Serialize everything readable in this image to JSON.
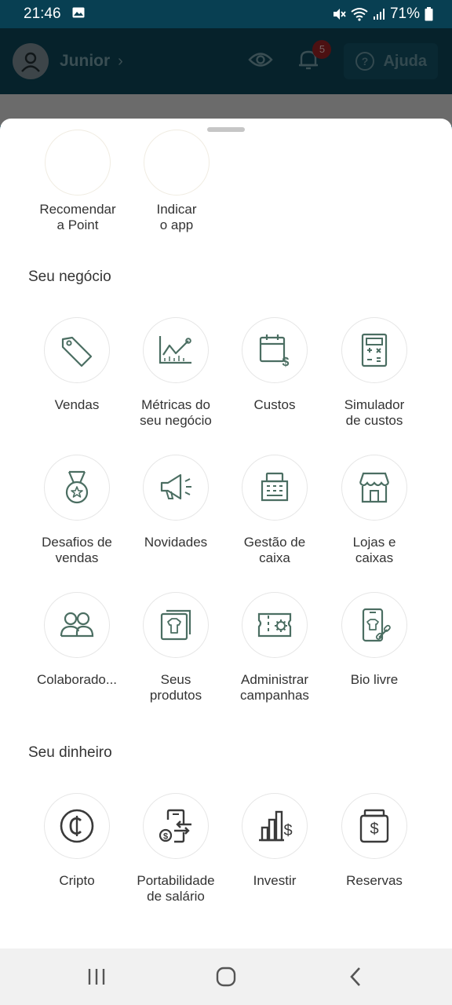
{
  "status_bar": {
    "time": "21:46",
    "battery": "71%"
  },
  "header": {
    "username": "Junior",
    "notification_count": "5",
    "help_label": "Ajuda"
  },
  "top_row": [
    {
      "label": "Recomendar\na Point"
    },
    {
      "label": "Indicar\no app"
    }
  ],
  "sections": {
    "business": {
      "title": "Seu negócio",
      "items": [
        {
          "label": "Vendas",
          "icon": "tag-icon"
        },
        {
          "label": "Métricas do\nseu negócio",
          "icon": "chart-line-icon"
        },
        {
          "label": "Custos",
          "icon": "calendar-cost-icon"
        },
        {
          "label": "Simulador\nde custos",
          "icon": "calculator-icon"
        },
        {
          "label": "Desafios de\nvendas",
          "icon": "medal-icon"
        },
        {
          "label": "Novidades",
          "icon": "megaphone-icon"
        },
        {
          "label": "Gestão de\ncaixa",
          "icon": "cash-register-icon"
        },
        {
          "label": "Lojas e\ncaixas",
          "icon": "store-icon"
        },
        {
          "label": "Colaborado...",
          "icon": "people-icon"
        },
        {
          "label": "Seus\nprodutos",
          "icon": "products-icon"
        },
        {
          "label": "Administrar\ncampanhas",
          "icon": "campaign-ticket-icon"
        },
        {
          "label": "Bio livre",
          "icon": "bio-link-icon"
        }
      ]
    },
    "money": {
      "title": "Seu dinheiro",
      "items": [
        {
          "label": "Cripto",
          "icon": "crypto-coin-icon"
        },
        {
          "label": "Portabilidade\nde salário",
          "icon": "salary-portability-icon"
        },
        {
          "label": "Investir",
          "icon": "invest-chart-icon"
        },
        {
          "label": "Reservas",
          "icon": "savings-jar-icon"
        }
      ]
    }
  },
  "nav": {
    "recent": "recent-apps-icon",
    "home": "home-icon",
    "back": "back-icon"
  },
  "colors": {
    "icon": "#4b6e62",
    "accent_dark": "#083f52"
  }
}
